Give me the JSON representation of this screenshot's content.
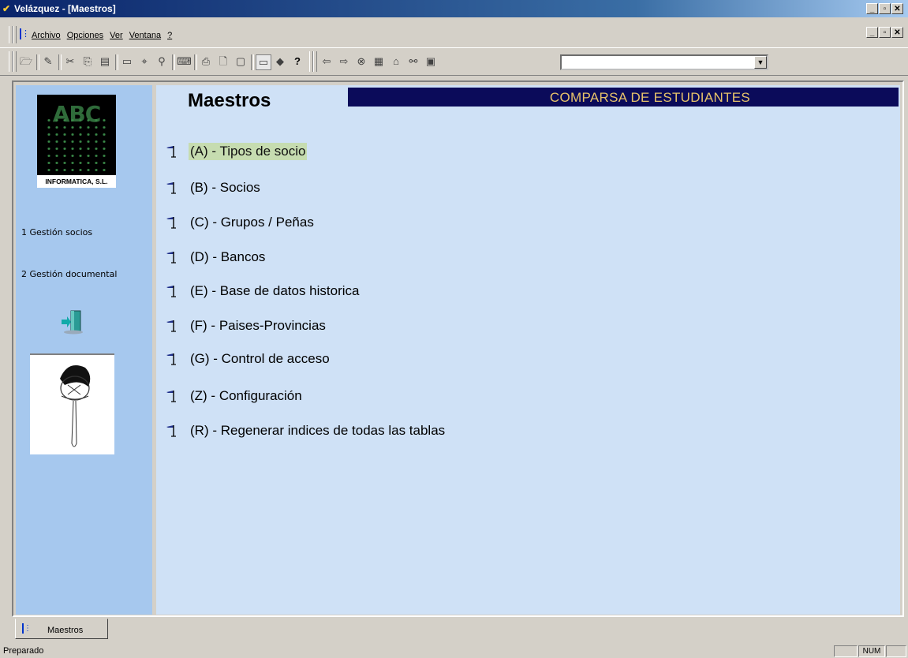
{
  "window": {
    "title": "Velázquez - [Maestros]"
  },
  "menu": {
    "items": [
      "Archivo",
      "Opciones",
      "Ver",
      "Ventana",
      "?"
    ]
  },
  "toolbar": {
    "icons": [
      "open-folder-icon",
      "edit-icon",
      "cut-icon",
      "copy-icon",
      "paste-icon",
      "window-icon",
      "find-icon",
      "zoom-icon",
      "scanner-icon",
      "print-icon",
      "print-preview-icon",
      "page-icon",
      "screen-icon",
      "eraser-icon",
      "help-icon",
      "back-arrow-icon",
      "forward-arrow-icon",
      "stop-icon",
      "refresh-icon",
      "home-icon",
      "search-binoculars-icon",
      "doc-icon"
    ],
    "combo_value": ""
  },
  "sidebar": {
    "logo_caption": "INFORMATICA, S.L.",
    "logo_text": "ABC",
    "links": [
      "1 Gestión socios",
      "2 Gestión documental"
    ]
  },
  "main": {
    "title": "Maestros",
    "header": "COMPARSA DE ESTUDIANTES",
    "items": [
      "(A) - Tipos de socio",
      "(B) - Socios",
      "(C) - Grupos /  Peñas",
      "(D) - Bancos",
      "(E) - Base de datos historica",
      "(F) - Paises-Provincias",
      "(G) - Control de acceso",
      "(Z) - Configuración",
      "(R) - Regenerar indices de todas las tablas"
    ],
    "selected_index": 0
  },
  "tab": {
    "label": "Maestros"
  },
  "status": {
    "text": "Preparado",
    "num": "NUM"
  },
  "colors": {
    "sidebar": "#a6c8ee",
    "main": "#cfe1f6",
    "header_bar": "#0b0b5a",
    "header_text": "#e7c36a",
    "selected": "#c6dcb0"
  }
}
